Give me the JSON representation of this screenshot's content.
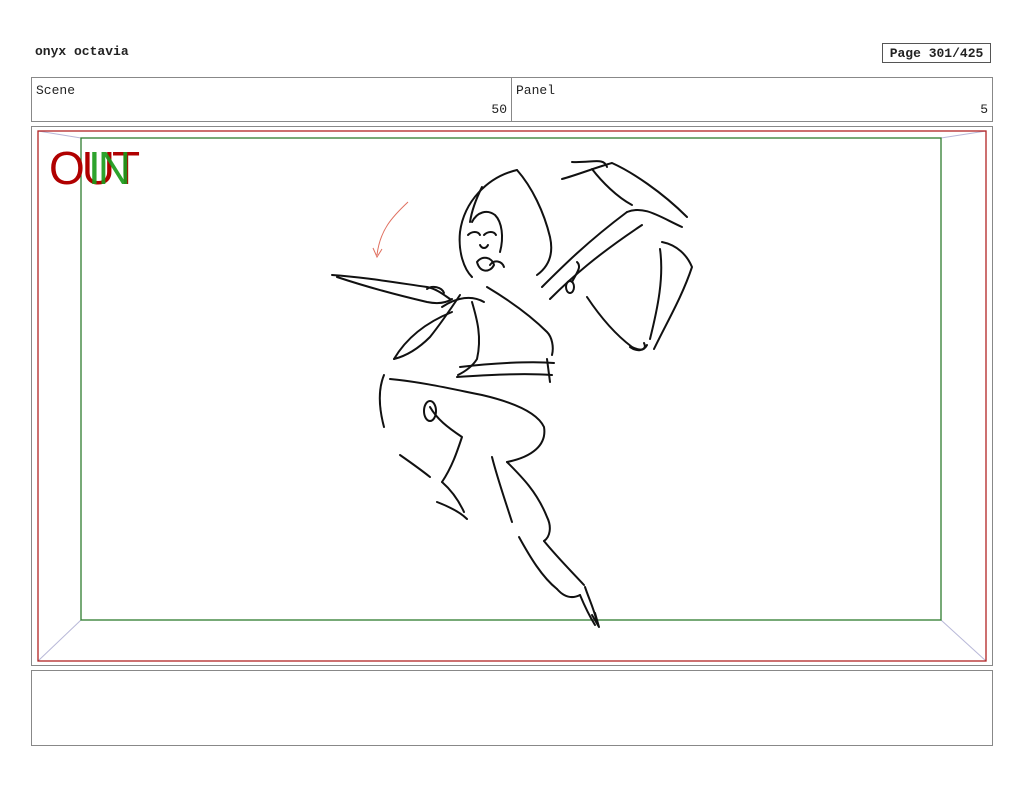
{
  "header": {
    "project_title": "onyx octavia",
    "page_label": "Page 301/425"
  },
  "info": {
    "scene_label": "Scene",
    "scene_value": "50",
    "panel_label": "Panel",
    "panel_value": "5"
  },
  "frame": {
    "out_tag": "OUT",
    "in_tag": "IN",
    "out_color": "#b00000",
    "in_color": "#1c9c1c"
  },
  "notes": {
    "text": ""
  }
}
